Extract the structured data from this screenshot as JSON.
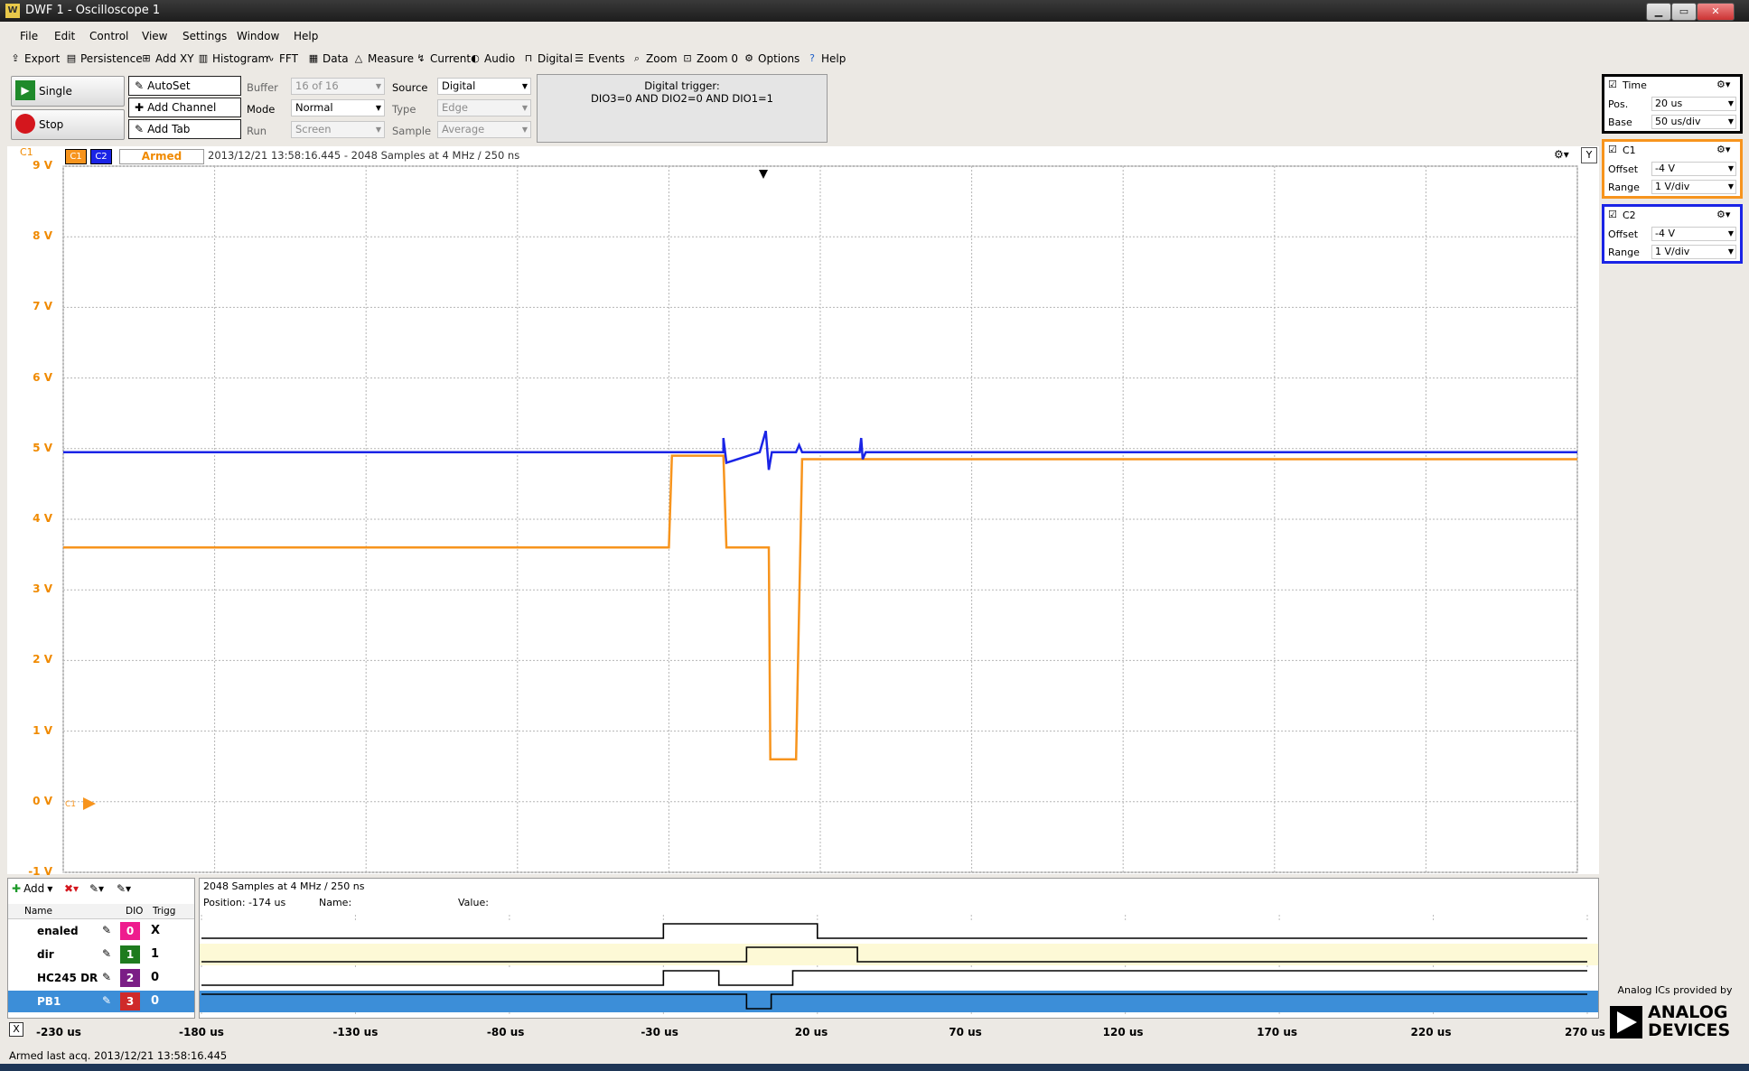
{
  "window": {
    "title": "DWF 1 - Oscilloscope 1"
  },
  "menu": [
    "File",
    "Edit",
    "Control",
    "View",
    "Settings",
    "Window",
    "Help"
  ],
  "toolbar": [
    "Export",
    "Persistence",
    "Add XY",
    "Histogram",
    "FFT",
    "Data",
    "Measure",
    "Current",
    "Audio",
    "Digital",
    "Events",
    "Zoom",
    "Zoom 0",
    "Options",
    "Help"
  ],
  "controls": {
    "single": "Single",
    "stop": "Stop",
    "autoset": "AutoSet",
    "add_channel": "Add Channel",
    "add_tab": "Add Tab",
    "buffer_label": "Buffer",
    "buffer_value": "16 of 16",
    "mode_label": "Mode",
    "mode_value": "Normal",
    "run_label": "Run",
    "run_value": "Screen",
    "source_label": "Source",
    "source_value": "Digital",
    "type_label": "Type",
    "type_value": "Edge",
    "sample_label": "Sample",
    "sample_value": "Average",
    "trigger_title": "Digital trigger:",
    "trigger_expr": "DIO3=0 AND DIO2=0 AND DIO1=1"
  },
  "scope": {
    "c1_tag": "C1",
    "c2_tag": "C2",
    "status": "Armed",
    "info": "2013/12/21 13:58:16.445 - 2048 Samples at 4 MHz / 250 ns",
    "corner_label": "C1",
    "y_label": "Y",
    "y_ticks": [
      "9 V",
      "8 V",
      "7 V",
      "6 V",
      "5 V",
      "4 V",
      "3 V",
      "2 V",
      "1 V",
      "0 V",
      "-1 V"
    ],
    "marker": "C1"
  },
  "panel": {
    "time": {
      "title": "Time",
      "pos_label": "Pos.",
      "pos_value": "20 us",
      "base_label": "Base",
      "base_value": "50 us/div"
    },
    "c1": {
      "title": "C1",
      "offset_label": "Offset",
      "offset_value": "-4 V",
      "range_label": "Range",
      "range_value": "1 V/div"
    },
    "c2": {
      "title": "C2",
      "offset_label": "Offset",
      "offset_value": "-4 V",
      "range_label": "Range",
      "range_value": "1 V/div"
    }
  },
  "colors": {
    "c1": "#f7941d",
    "c2": "#1a24e6",
    "grid": "#b5b5b5"
  },
  "logic": {
    "add": "Add",
    "info": "2048 Samples at 4 MHz / 250 ns",
    "position": "Position: -174 us",
    "name_label": "Name:",
    "value_label": "Value:",
    "col_name": "Name",
    "col_dio": "DIO",
    "col_trig": "Trigg",
    "signals": [
      {
        "name": "enaled",
        "dio": "0",
        "trig": "X",
        "color": "#ee1c8e"
      },
      {
        "name": "dir",
        "dio": "1",
        "trig": "1",
        "color": "#1e7b1e"
      },
      {
        "name": "HC245 DR",
        "dio": "2",
        "trig": "0",
        "color": "#7b1e86"
      },
      {
        "name": "PB1",
        "dio": "3",
        "trig": "0",
        "color": "#cf2a2a"
      }
    ],
    "x_close": "X",
    "x_ticks": [
      "-230 us",
      "-180 us",
      "-130 us",
      "-80 us",
      "-30 us",
      "20 us",
      "70 us",
      "120 us",
      "170 us",
      "220 us",
      "270 us"
    ]
  },
  "status": "Armed last acq. 2013/12/21  13:58:16.445",
  "brand": {
    "provided": "Analog ICs provided by",
    "line1": "ANALOG",
    "line2": "DEVICES"
  }
}
